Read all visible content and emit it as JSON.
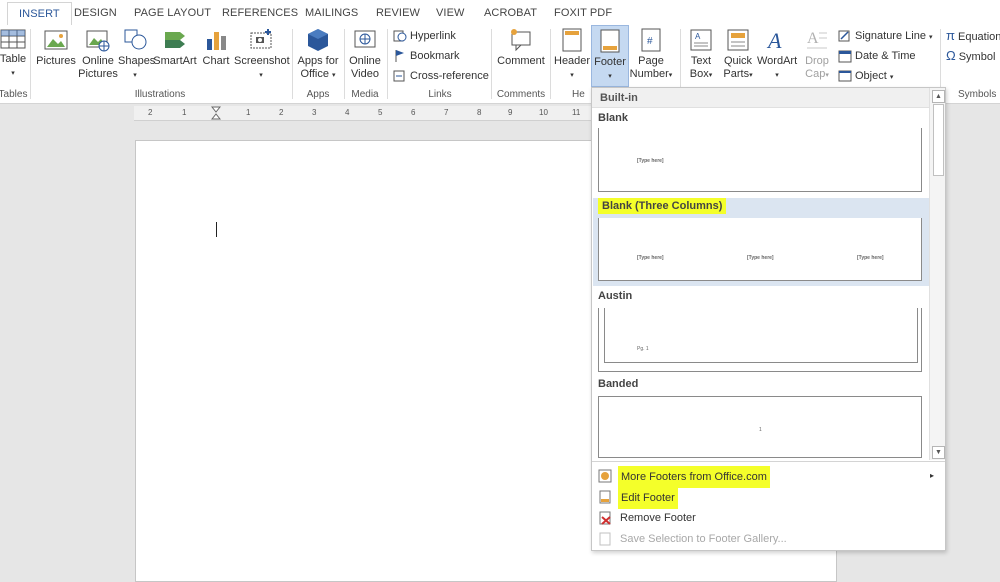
{
  "tabs": [
    "INSERT",
    "DESIGN",
    "PAGE LAYOUT",
    "REFERENCES",
    "MAILINGS",
    "REVIEW",
    "VIEW",
    "ACROBAT",
    "FOXIT PDF"
  ],
  "ribbon": {
    "table": {
      "label": "Table",
      "group": "Tables"
    },
    "pictures": "Pictures",
    "online_pictures_1": "Online",
    "online_pictures_2": "Pictures",
    "shapes": "Shapes",
    "smartart": "SmartArt",
    "chart": "Chart",
    "screenshot": "Screenshot",
    "illustrations_group": "Illustrations",
    "apps_1": "Apps for",
    "apps_2": "Office",
    "apps_group": "Apps",
    "video_1": "Online",
    "video_2": "Video",
    "media_group": "Media",
    "hyperlink": "Hyperlink",
    "bookmark": "Bookmark",
    "cross_reference": "Cross-reference",
    "links_group": "Links",
    "comment": "Comment",
    "comments_group": "Comments",
    "header": "Header",
    "header_group": "He",
    "footer": "Footer",
    "page_number_1": "Page",
    "page_number_2": "Number",
    "textbox_1": "Text",
    "textbox_2": "Box",
    "quickparts_1": "Quick",
    "quickparts_2": "Parts",
    "wordart": "WordArt",
    "dropcap_1": "Drop",
    "dropcap_2": "Cap",
    "signature_line": "Signature Line",
    "date_time": "Date & Time",
    "object": "Object",
    "equation": "Equation",
    "symbol": "Symbol",
    "symbols_group": "Symbols"
  },
  "ruler_ticks": [
    "2",
    "1",
    "1",
    "2",
    "3",
    "4",
    "5",
    "6",
    "7",
    "8",
    "9",
    "10",
    "11"
  ],
  "dropdown": {
    "header": "Built-in",
    "galleries": [
      {
        "label": "Blank",
        "placeholder": "[Type here]"
      },
      {
        "label": "Blank (Three Columns)",
        "placeholder": "[Type here]"
      },
      {
        "label": "Austin",
        "placeholder": "Pg. 1"
      },
      {
        "label": "Banded",
        "placeholder": "1"
      }
    ],
    "menu": {
      "more": "More Footers from Office.com",
      "edit": "Edit Footer",
      "remove": "Remove Footer",
      "save": "Save Selection to Footer Gallery..."
    }
  },
  "colors": {
    "accent": "#2b579a",
    "highlight": "#f4ff2a",
    "selected": "#dbe5f1"
  }
}
